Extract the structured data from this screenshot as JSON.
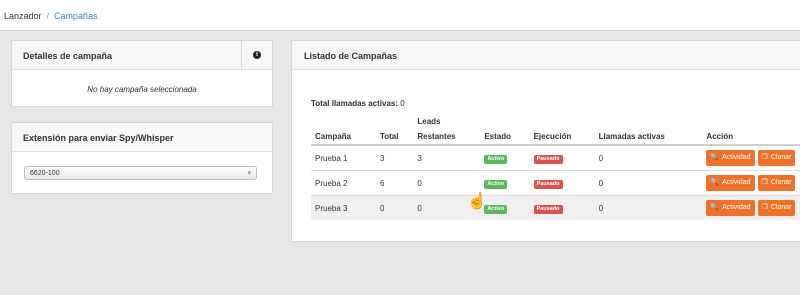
{
  "breadcrumb": {
    "root": "Lanzador",
    "separator": "/",
    "current": "Campañas"
  },
  "details_panel": {
    "title": "Detalles de campaña",
    "info_icon": "i",
    "empty_message": "No hay campaña seleccionada"
  },
  "extension_panel": {
    "title": "Extensión para enviar Spy/Whisper",
    "selected": "6620-100",
    "caret": "▾"
  },
  "list_panel": {
    "title": "Listado de Campañas",
    "total_label": "Total llamadas activas:",
    "total_value": "0",
    "group_header": "Leads",
    "columns": [
      "Campaña",
      "Total",
      "Restantes",
      "Estado",
      "Ejecución",
      "Llamadas activas",
      "Acción"
    ],
    "rows": [
      {
        "campaign": "Prueba 1",
        "total": "3",
        "remaining": "3",
        "status": "Activo",
        "execution": "Pausado",
        "active_calls": "0"
      },
      {
        "campaign": "Prueba 2",
        "total": "6",
        "remaining": "0",
        "status": "Activo",
        "execution": "Pausado",
        "active_calls": "0"
      },
      {
        "campaign": "Prueba 3",
        "total": "0",
        "remaining": "0",
        "status": "Activo",
        "execution": "Pausado",
        "active_calls": "0"
      }
    ],
    "actions": {
      "activity": "Actividad",
      "clone": "Clonar"
    }
  },
  "colors": {
    "accent": "#3a87c8",
    "action_button": "#f0722a",
    "badge_green": "#5cb85c",
    "badge_red": "#d9534f"
  }
}
